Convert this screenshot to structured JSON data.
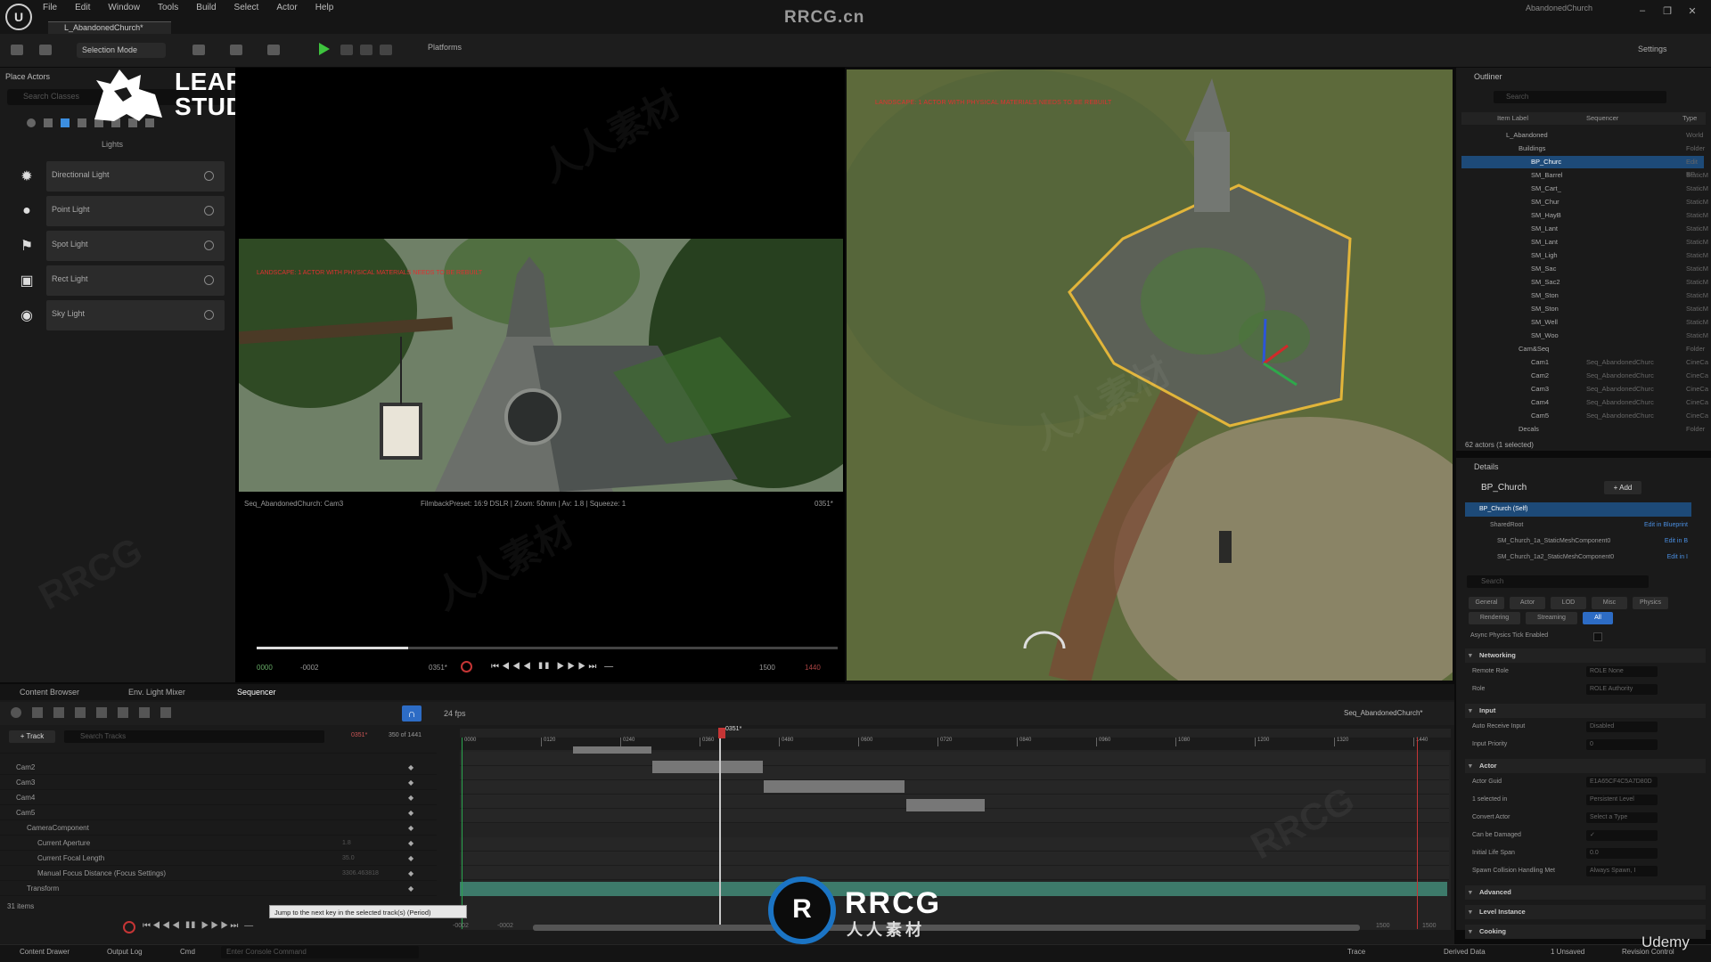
{
  "app": {
    "brand": "RRCG.cn",
    "project_name": "AbandonedChurch",
    "level_tab": "L_AbandonedChurch*",
    "menus": [
      "File",
      "Edit",
      "Window",
      "Tools",
      "Build",
      "Select",
      "Actor",
      "Help"
    ]
  },
  "toolbar": {
    "selection_mode": "Selection Mode",
    "platforms": "Platforms",
    "settings": "Settings",
    "play_color": "#3ec43e"
  },
  "place_actors": {
    "title": "Place Actors",
    "search_placeholder": "Search Classes",
    "category": "Lights",
    "items": [
      {
        "label": "Directional Light",
        "icon": "sun-icon"
      },
      {
        "label": "Point Light",
        "icon": "bulb-icon"
      },
      {
        "label": "Spot Light",
        "icon": "spotlight-icon"
      },
      {
        "label": "Rect Light",
        "icon": "rect-light-icon"
      },
      {
        "label": "Sky Light",
        "icon": "sky-light-icon"
      }
    ]
  },
  "logo": {
    "line1": "LEARTES",
    "line2": "STUDIOS"
  },
  "cinematic_viewport": {
    "warning": "LANDSCAPE: 1 ACTOR WITH PHYSICAL MATERIALS NEEDS TO BE REBUILT",
    "shot": "Seq_AbandonedChurch: Cam3",
    "filmback": "FilmbackPreset: 16:9 DSLR | Zoom: 50mm | Av: 1.8 | Squeeze: 1",
    "frame": "0351*",
    "start_frame": "0000",
    "start_offset": "-0002",
    "current_frame": "0351*",
    "end_frame": "1500",
    "end_offset": "1440",
    "progress": 0.26
  },
  "top_viewport": {
    "warning": "LANDSCAPE: 1 ACTOR WITH PHYSICAL MATERIALS NEEDS TO BE REBUILT"
  },
  "outliner": {
    "title": "Outliner",
    "search_placeholder": "Search",
    "col_label": "Item Label",
    "col_sequence": "Sequencer",
    "col_type": "Type",
    "rows": [
      {
        "name": "L_Abandoned",
        "seq": "",
        "type": "World",
        "indent": 1
      },
      {
        "name": "Buildings",
        "seq": "",
        "type": "Folder",
        "indent": 2
      },
      {
        "name": "BP_Churc",
        "seq": "",
        "type": "Edit BP",
        "indent": 3,
        "selected": true
      },
      {
        "name": "SM_Barrel",
        "seq": "",
        "type": "StaticM",
        "indent": 3
      },
      {
        "name": "SM_Cart_",
        "seq": "",
        "type": "StaticM",
        "indent": 3
      },
      {
        "name": "SM_Chur",
        "seq": "",
        "type": "StaticM",
        "indent": 3
      },
      {
        "name": "SM_HayB",
        "seq": "",
        "type": "StaticM",
        "indent": 3
      },
      {
        "name": "SM_Lant",
        "seq": "",
        "type": "StaticM",
        "indent": 3
      },
      {
        "name": "SM_Lant",
        "seq": "",
        "type": "StaticM",
        "indent": 3
      },
      {
        "name": "SM_Ligh",
        "seq": "",
        "type": "StaticM",
        "indent": 3
      },
      {
        "name": "SM_Sac",
        "seq": "",
        "type": "StaticM",
        "indent": 3
      },
      {
        "name": "SM_Sac2",
        "seq": "",
        "type": "StaticM",
        "indent": 3
      },
      {
        "name": "SM_Ston",
        "seq": "",
        "type": "StaticM",
        "indent": 3
      },
      {
        "name": "SM_Ston",
        "seq": "",
        "type": "StaticM",
        "indent": 3
      },
      {
        "name": "SM_Well",
        "seq": "",
        "type": "StaticM",
        "indent": 3
      },
      {
        "name": "SM_Woo",
        "seq": "",
        "type": "StaticM",
        "indent": 3
      },
      {
        "name": "Cam&Seq",
        "seq": "",
        "type": "Folder",
        "indent": 2
      },
      {
        "name": "Cam1",
        "seq": "Seq_AbandonedChurc",
        "type": "CineCa",
        "indent": 3
      },
      {
        "name": "Cam2",
        "seq": "Seq_AbandonedChurc",
        "type": "CineCa",
        "indent": 3
      },
      {
        "name": "Cam3",
        "seq": "Seq_AbandonedChurc",
        "type": "CineCa",
        "indent": 3
      },
      {
        "name": "Cam4",
        "seq": "Seq_AbandonedChurc",
        "type": "CineCa",
        "indent": 3
      },
      {
        "name": "Cam5",
        "seq": "Seq_AbandonedChurc",
        "type": "CineCa",
        "indent": 3
      },
      {
        "name": "Decals",
        "seq": "",
        "type": "Folder",
        "indent": 2
      }
    ],
    "status": "62 actors (1 selected)"
  },
  "details": {
    "title": "Details",
    "actor_name": "BP_Church",
    "add_label": "+ Add",
    "components": [
      {
        "name": "BP_Church (Self)",
        "link": "",
        "selected": true
      },
      {
        "name": "SharedRoot",
        "link": "Edit in Blueprint"
      },
      {
        "name": "SM_Church_1a_StaticMeshComponent0",
        "link": "Edit in B"
      },
      {
        "name": "SM_Church_1a2_StaticMeshComponent0",
        "link": "Edit in I"
      }
    ],
    "search_placeholder": "Search",
    "tabs_row1": [
      "General",
      "Actor",
      "LOD",
      "Misc",
      "Physics"
    ],
    "tabs_row2": [
      "Rendering",
      "Streaming",
      "All"
    ],
    "async_label": "Async Physics Tick Enabled",
    "sections": [
      {
        "title": "Networking",
        "rows": [
          {
            "label": "Remote Role",
            "value": "ROLE None"
          },
          {
            "label": "Role",
            "value": "ROLE Authority"
          }
        ]
      },
      {
        "title": "Input",
        "rows": [
          {
            "label": "Auto Receive Input",
            "value": "Disabled"
          },
          {
            "label": "Input Priority",
            "value": "0"
          }
        ]
      },
      {
        "title": "Actor",
        "rows": [
          {
            "label": "Actor Guid",
            "value": "E1A65CF4C5A7D80D"
          },
          {
            "label": "1 selected in",
            "value": "Persistent Level"
          },
          {
            "label": "Convert Actor",
            "value": "Select a Type"
          },
          {
            "label": "Can be Damaged",
            "value": "✓"
          },
          {
            "label": "Initial Life Span",
            "value": "0.0"
          },
          {
            "label": "Spawn Collision Handling Met",
            "value": "Always Spawn, I"
          }
        ]
      },
      {
        "title": "Advanced",
        "rows": []
      },
      {
        "title": "Level Instance",
        "rows": []
      },
      {
        "title": "Cooking",
        "rows": []
      }
    ]
  },
  "sequencer": {
    "tabs": [
      "Content Browser",
      "Env. Light Mixer",
      "Sequencer"
    ],
    "fps": "24 fps",
    "sequence_name": "Seq_AbandonedChurch*",
    "track_label": "+ Track",
    "search_placeholder": "Search Tracks",
    "current_frame": "0351*",
    "frame_count": "350 of 1441",
    "tracks": [
      {
        "name": "Cam2",
        "indent": 1,
        "value": ""
      },
      {
        "name": "Cam3",
        "indent": 1,
        "value": ""
      },
      {
        "name": "Cam4",
        "indent": 1,
        "value": ""
      },
      {
        "name": "Cam5",
        "indent": 1,
        "value": ""
      },
      {
        "name": "CameraComponent",
        "indent": 2,
        "value": ""
      },
      {
        "name": "Current Aperture",
        "indent": 3,
        "value": "1.8"
      },
      {
        "name": "Current Focal Length",
        "indent": 3,
        "value": "35.0"
      },
      {
        "name": "Manual Focus Distance (Focus Settings)",
        "indent": 3,
        "value": "3306.463818"
      },
      {
        "name": "Transform",
        "indent": 2,
        "value": ""
      }
    ],
    "items_count": "31 items",
    "ruler": [
      "0000",
      "0120",
      "0240",
      "0360",
      "0480",
      "0600",
      "0720",
      "0840",
      "0960",
      "1080",
      "1200",
      "1320",
      "1440"
    ],
    "playhead_label": "0351*",
    "tooltip": "Jump to the next key in the selected track(s) (Period)",
    "range_lo": "-0002",
    "range_lo2": "-0002",
    "range_hi": "1500",
    "range_hi2": "1500"
  },
  "statusbar": {
    "content_drawer": "Content Drawer",
    "output_log": "Output Log",
    "cmd": "Cmd",
    "console_placeholder": "Enter Console Command",
    "trace": "Trace",
    "derived_data": "Derived Data",
    "unsaved": "1 Unsaved",
    "revision": "Revision Control"
  },
  "overlay": {
    "rrcg": "RRCG",
    "rrcg_cn": "人人素材",
    "udemy": "Udemy"
  }
}
